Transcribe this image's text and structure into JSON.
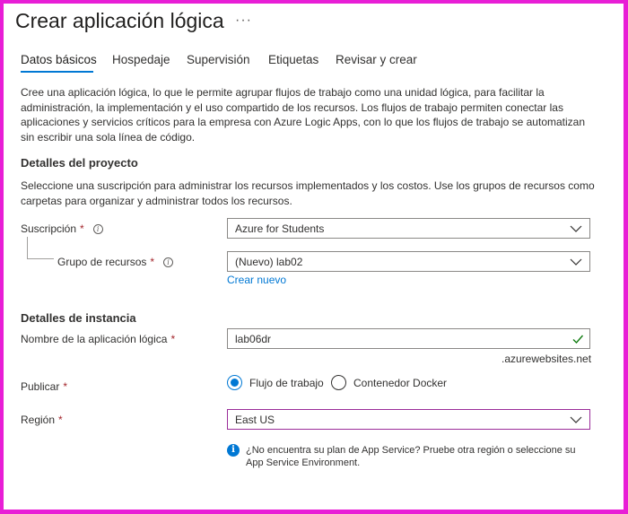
{
  "page": {
    "title": "Crear aplicación lógica",
    "more": "···"
  },
  "tabs": [
    {
      "label": "Datos básicos",
      "active": true
    },
    {
      "label": "Hospedaje"
    },
    {
      "label": "Supervisión"
    },
    {
      "label": "Etiquetas"
    },
    {
      "label": "Revisar y crear"
    }
  ],
  "intro": "Cree una aplicación lógica, lo que le permite agrupar flujos de trabajo como una unidad lógica, para facilitar la administración, la implementación y el uso compartido de los recursos. Los flujos de trabajo permiten conectar las aplicaciones y servicios críticos para la empresa con Azure Logic Apps, con lo que los flujos de trabajo se automatizan sin escribir una sola línea de código.",
  "project": {
    "heading": "Detalles del proyecto",
    "description": "Seleccione una suscripción para administrar los recursos implementados y los costos. Use los grupos de recursos como carpetas para organizar y administrar todos los recursos.",
    "subscription_label": "Suscripción",
    "subscription_value": "Azure for Students",
    "resource_group_label": "Grupo de recursos",
    "resource_group_value": "(Nuevo) lab02",
    "create_new": "Crear nuevo"
  },
  "instance": {
    "heading": "Detalles de instancia",
    "name_label": "Nombre de la aplicación lógica",
    "name_value": "lab06dr",
    "name_suffix": ".azurewebsites.net",
    "publish_label": "Publicar",
    "publish_options": [
      "Flujo de trabajo",
      "Contenedor Docker"
    ],
    "publish_selected": 0,
    "region_label": "Región",
    "region_value": "East US",
    "region_note": "¿No encuentra su plan de App Service? Pruebe otra región o seleccione su App Service Environment."
  },
  "required_mark": "*",
  "info_mark": "i",
  "colors": {
    "accent": "#0078d4",
    "required": "#a4262c",
    "success": "#107c10",
    "focus_border": "#9b2d9a",
    "frame": "#e81ed6"
  }
}
